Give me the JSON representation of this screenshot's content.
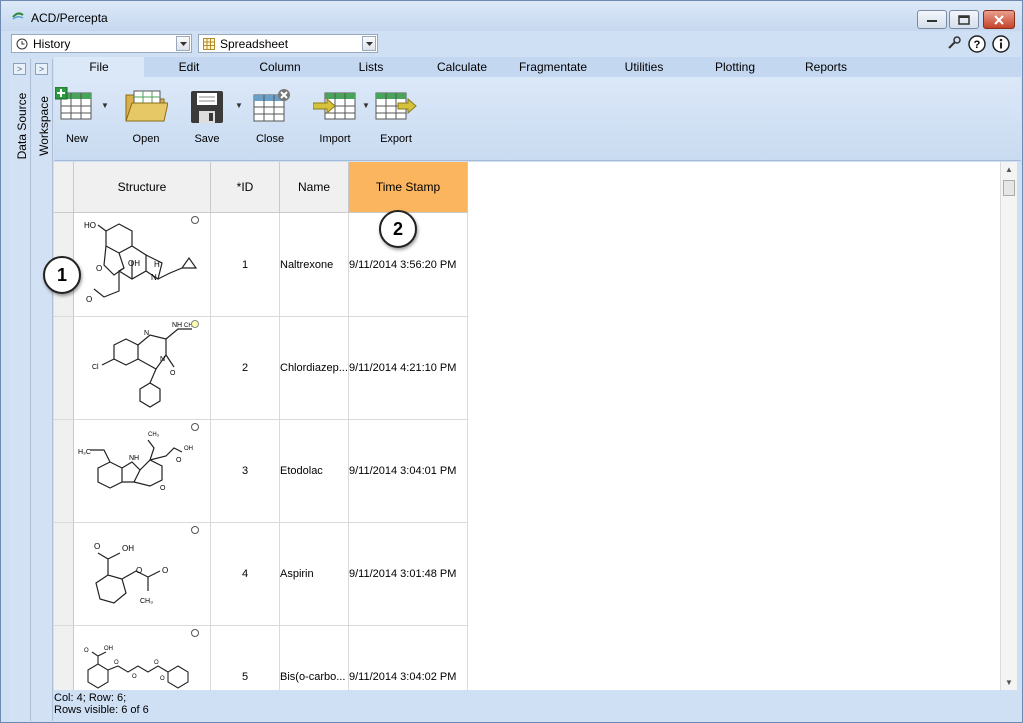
{
  "window": {
    "title": "ACD/Percepta",
    "accent_color": "#fbb55f"
  },
  "toolbar_top": {
    "history_label": "History",
    "view_label": "Spreadsheet"
  },
  "side_panels": {
    "data_source": "Data Source",
    "workspace": "Workspace"
  },
  "menu": {
    "tabs": [
      "File",
      "Edit",
      "Column",
      "Lists",
      "Calculate",
      "Fragmentate",
      "Utilities",
      "Plotting",
      "Reports"
    ],
    "active": "File"
  },
  "ribbon": {
    "buttons": [
      {
        "label": "New",
        "icon": "new-table-icon"
      },
      {
        "label": "Open",
        "icon": "open-folder-icon"
      },
      {
        "label": "Save",
        "icon": "floppy-disk-icon"
      },
      {
        "label": "Close",
        "icon": "close-table-icon"
      },
      {
        "label": "Import",
        "icon": "import-table-icon"
      },
      {
        "label": "Export",
        "icon": "export-table-icon"
      }
    ]
  },
  "grid": {
    "columns": [
      "Structure",
      "*ID",
      "Name",
      "Time Stamp"
    ],
    "selected_column": "Time Stamp",
    "rows": [
      {
        "id": "1",
        "name": "Naltrexone",
        "timestamp": "9/11/2014 3:56:20 PM"
      },
      {
        "id": "2",
        "name": "Chlordiazep...",
        "timestamp": "9/11/2014 4:21:10 PM"
      },
      {
        "id": "3",
        "name": "Etodolac",
        "timestamp": "9/11/2014 3:04:01 PM"
      },
      {
        "id": "4",
        "name": "Aspirin",
        "timestamp": "9/11/2014 3:01:48 PM"
      },
      {
        "id": "5",
        "name": "Bis(o-carbo...",
        "timestamp": "9/11/2014 3:04:02 PM"
      }
    ]
  },
  "molecule_labels": {
    "r1": [
      "HO",
      "OH",
      "H",
      "N",
      "O",
      "O"
    ],
    "r2": [
      "N",
      "NH",
      "CH₃",
      "Cl",
      "N",
      "O"
    ],
    "r3": [
      "H₃C",
      "CH₃",
      "NH",
      "OH",
      "O",
      "O"
    ],
    "r4": [
      "O",
      "OH",
      "O",
      "O",
      "CH₃"
    ],
    "r5": [
      "O",
      "OH",
      "O",
      "O",
      "O",
      "O"
    ]
  },
  "callouts": {
    "first": "1",
    "second": "2"
  },
  "status": {
    "position": "Col: 4; Row: 6;",
    "rows_visible": "Rows visible: 6 of 6"
  }
}
